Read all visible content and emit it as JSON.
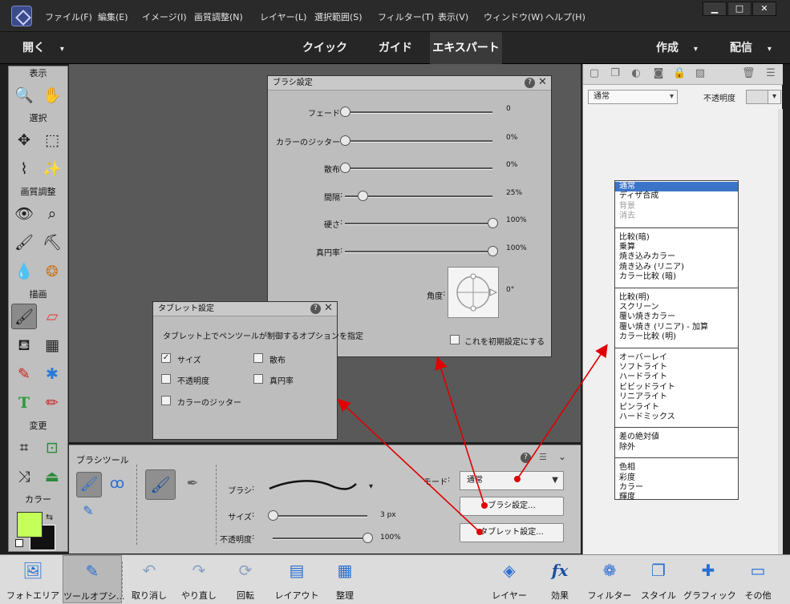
{
  "menu": {
    "items": [
      "ファイル(F)",
      "編集(E)",
      "イメージ(I)",
      "画質調整(N)",
      "レイヤー(L)",
      "選択範囲(S)",
      "フィルター(T)",
      "表示(V)",
      "ウィンドウ(W)",
      "ヘルプ(H)"
    ],
    "window_controls": [
      "▁",
      "□",
      "✕"
    ]
  },
  "modebar": {
    "open_label": "開く",
    "tabs": [
      "クイック",
      "ガイド",
      "エキスパート"
    ],
    "active_tab": "エキスパート",
    "create_label": "作成",
    "share_label": "配信"
  },
  "toolbox": {
    "sections": [
      "表示",
      "選択",
      "画質調整",
      "描画",
      "変更",
      "カラー"
    ]
  },
  "brush_settings": {
    "title": "ブラシ設定",
    "sliders": [
      {
        "label": "フェード",
        "value": "0",
        "pos": 0.0
      },
      {
        "label": "カラーのジッター",
        "value": "0%",
        "pos": 0.0
      },
      {
        "label": "散布",
        "value": "0%",
        "pos": 0.0
      },
      {
        "label": "間隔",
        "value": "25%",
        "pos": 0.12
      },
      {
        "label": "硬さ",
        "value": "100%",
        "pos": 1.0
      },
      {
        "label": "真円率",
        "value": "100%",
        "pos": 1.0
      }
    ],
    "angle_label": "角度",
    "angle_value": "0°",
    "default_checkbox": "これを初期設定にする"
  },
  "tablet_settings": {
    "title": "タブレット設定",
    "description": "タブレット上でペンツールが制御するオプションを指定",
    "options": [
      {
        "label": "サイズ",
        "checked": true
      },
      {
        "label": "散布",
        "checked": false
      },
      {
        "label": "不透明度",
        "checked": false
      },
      {
        "label": "真円率",
        "checked": false
      },
      {
        "label": "カラーのジッター",
        "checked": false
      }
    ]
  },
  "tool_options": {
    "title": "ブラシツール",
    "brush_label": "ブラシ",
    "size_label": "サイズ",
    "size_value": "3 px",
    "size_pos": 0.0,
    "opacity_label": "不透明度",
    "opacity_value": "100%",
    "opacity_pos": 1.0,
    "mode_label": "モード",
    "mode_value": "通常",
    "brush_settings_button": "ブラシ設定...",
    "tablet_settings_button": "タブレット設定..."
  },
  "layers_panel": {
    "blend_value": "通常",
    "opacity_label": "不透明度"
  },
  "blend_modes": [
    [
      "通常",
      "ディザ合成",
      "背景",
      "消去"
    ],
    [
      "比較(暗)",
      "乗算",
      "焼き込みカラー",
      "焼き込み (リニア)",
      "カラー比較 (暗)"
    ],
    [
      "比較(明)",
      "スクリーン",
      "覆い焼きカラー",
      "覆い焼き (リニア) - 加算",
      "カラー比較 (明)"
    ],
    [
      "オーバーレイ",
      "ソフトライト",
      "ハードライト",
      "ビビッドライト",
      "リニアライト",
      "ピンライト",
      "ハードミックス"
    ],
    [
      "差の絶対値",
      "除外"
    ],
    [
      "色相",
      "彩度",
      "カラー",
      "輝度"
    ]
  ],
  "blend_selected": "通常",
  "blend_disabled": [
    "背景",
    "消去"
  ],
  "bottombar": {
    "left": [
      {
        "label": "フォトエリア",
        "icon": "photo-bin-icon"
      },
      {
        "label": "ツールオプシ...",
        "icon": "tool-options-icon"
      },
      {
        "label": "取り消し",
        "icon": "undo-icon"
      },
      {
        "label": "やり直し",
        "icon": "redo-icon"
      },
      {
        "label": "回転",
        "icon": "rotate-icon"
      },
      {
        "label": "レイアウト",
        "icon": "layout-icon"
      },
      {
        "label": "整理",
        "icon": "organizer-icon"
      }
    ],
    "right": [
      {
        "label": "レイヤー",
        "icon": "layers-icon"
      },
      {
        "label": "効果",
        "icon": "effects-icon"
      },
      {
        "label": "フィルター",
        "icon": "filters-icon"
      },
      {
        "label": "スタイル",
        "icon": "styles-icon"
      },
      {
        "label": "グラフィック",
        "icon": "graphics-icon"
      },
      {
        "label": "その他",
        "icon": "more-icon"
      }
    ]
  },
  "colors": {
    "foreground": "#c4ff5a",
    "background": "#111111",
    "arrow": "#e00000",
    "highlight": "#3c74c8"
  }
}
